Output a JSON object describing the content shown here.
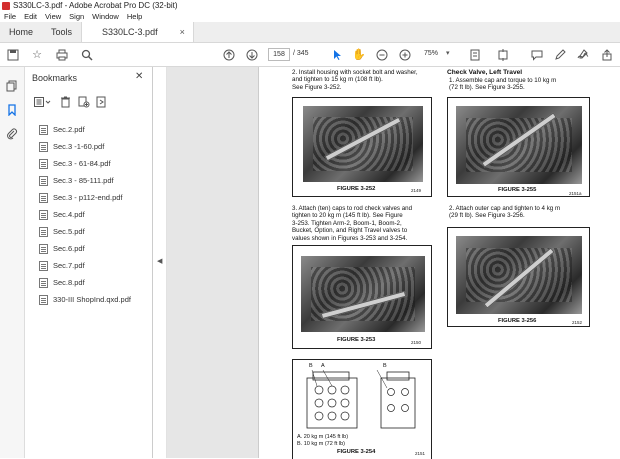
{
  "window": {
    "title": "S330LC-3.pdf - Adobe Acrobat Pro DC (32-bit)"
  },
  "menu": [
    "File",
    "Edit",
    "View",
    "Sign",
    "Window",
    "Help"
  ],
  "tabs": {
    "home": "Home",
    "tools": "Tools",
    "doc": "S330LC-3.pdf",
    "close": "×"
  },
  "toolbar": {
    "page_current": "158",
    "page_total": "/ 345",
    "zoom": "75%"
  },
  "bookmarks": {
    "title": "Bookmarks",
    "close": "✕",
    "items": [
      "Sec.2.pdf",
      "Sec.3 -1-60.pdf",
      "Sec.3 - 61-84.pdf",
      "Sec.3 - 85-111.pdf",
      "Sec.3 - p112-end.pdf",
      "Sec.4.pdf",
      "Sec.5.pdf",
      "Sec.6.pdf",
      "Sec.7.pdf",
      "Sec.8.pdf",
      "330-III ShopInd.qxd.pdf"
    ]
  },
  "document": {
    "step2_left": "2.    Install housing with socket bolt and washer,\n       and tighten to 15 kg m (108 ft lb).\n       See Figure 3-252.",
    "fig252": {
      "caption": "FIGURE 3-252",
      "num": "2149"
    },
    "step3": "3.    Attach (ten) caps to rod check valves and\n       tighten to 20 kg m (145 ft lb). See Figure\n       3-253. Tighten Arm-2, Boom-1, Boom-2,\n       Bucket, Option, and Right Travel valves to\n       values shown in Figures 3-253 and 3-254.",
    "fig253": {
      "caption": "FIGURE 3-253",
      "num": "2150"
    },
    "fig254": {
      "caption": "FIGURE 3-254",
      "label_a": "A",
      "label_b": "B",
      "note_a": "A. 20 kg m (145 ft lb)",
      "note_b": "B. 10 kg m (72 ft lb)",
      "num": "2151"
    },
    "heading_right": "Check Valve, Left Travel",
    "step1_right": "1.    Assemble cap and torque to 10 kg m\n       (72 ft lb). See Figure 3-255.",
    "fig255": {
      "caption": "FIGURE 3-255",
      "num": "2151a"
    },
    "step2_right": "2.    Attach outer cap and tighten to 4 kg m\n       (29 ft lb). See Figure 3-256.",
    "fig256": {
      "caption": "FIGURE 3-256",
      "num": "2152"
    }
  },
  "icons": {
    "save": "💾",
    "bookmark_star": "☆",
    "print": "⎙",
    "search": "⌕",
    "prev_page": "↑",
    "next_page": "↓",
    "select": "▲",
    "hand": "✋",
    "zoom_out": "⊖",
    "zoom_in": "⊕",
    "fit": "⊡",
    "scroll_mode": "⇅",
    "comment": "💬",
    "highlight": "✎",
    "sign": "✍",
    "share": "⇪",
    "rail_pages": "❐",
    "rail_bookmarks": "🔖",
    "rail_attachments": "📎",
    "bm_options": "≡",
    "bm_delete": "🗑",
    "bm_new": "⊞",
    "bm_expand": "⊟",
    "splitter_arrow": "◀"
  }
}
